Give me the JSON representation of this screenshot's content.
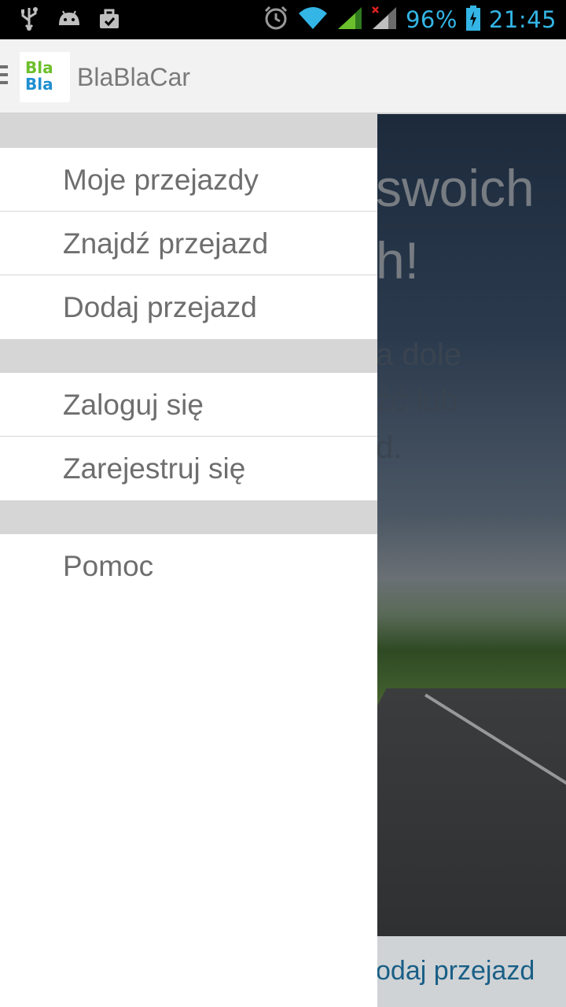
{
  "status_bar": {
    "battery_percent": "96%",
    "time": "21:45",
    "accent_color": "#33b5e5",
    "icons": [
      "usb-icon",
      "android-debug-icon",
      "briefcase-icon",
      "alarm-icon",
      "wifi-icon",
      "signal-icon",
      "signal-no-data-icon",
      "battery-charging-icon"
    ]
  },
  "action_bar": {
    "logo_line1": "Bla",
    "logo_line2": "Bla",
    "title": "BlaBlaCar"
  },
  "background": {
    "heading_line1": "swoich",
    "heading_line2": "h!",
    "text_line1": "a dole",
    "text_line2": "źć lub",
    "text_line3": "d.",
    "bottom_button": "odaj przejazd"
  },
  "drawer": {
    "section1": [
      "Moje przejazdy",
      "Znajdź przejazd",
      "Dodaj przejazd"
    ],
    "section2": [
      "Zaloguj się",
      "Zarejestruj się"
    ],
    "section3": [
      "Pomoc"
    ]
  }
}
